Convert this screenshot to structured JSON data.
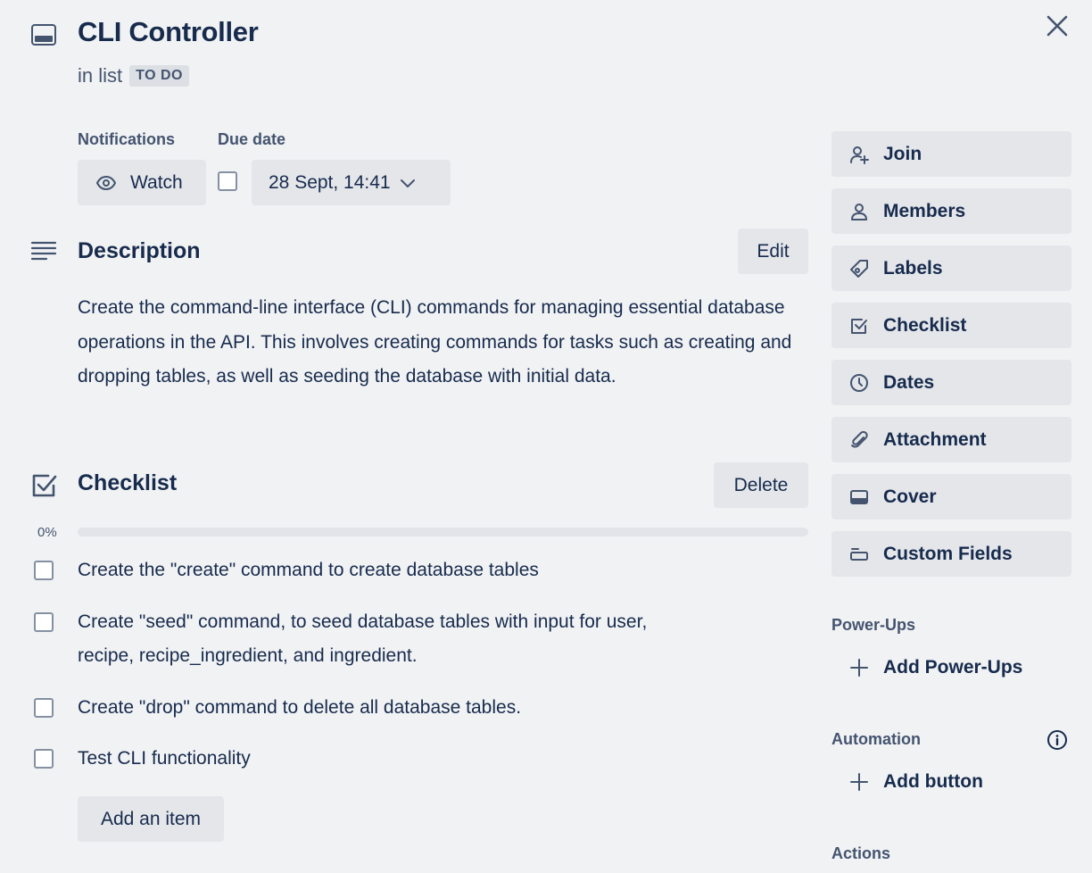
{
  "card": {
    "title": "CLI Controller",
    "in_list_prefix": "in list",
    "list_name": "TO DO"
  },
  "notifications": {
    "label": "Notifications",
    "watch_label": "Watch"
  },
  "due_date": {
    "label": "Due date",
    "value": "28 Sept, 14:41",
    "complete": false
  },
  "description": {
    "heading": "Description",
    "edit_label": "Edit",
    "text": "Create the command-line interface (CLI) commands for managing essential database operations in the API. This involves creating commands for tasks such as creating and dropping tables, as well as seeding the database with initial data."
  },
  "checklist": {
    "heading": "Checklist",
    "delete_label": "Delete",
    "progress_label": "0%",
    "progress": 0,
    "items": [
      {
        "text": "Create the \"create\" command to create database tables",
        "checked": false
      },
      {
        "text": "Create \"seed\" command, to seed database tables with input for user, recipe, recipe_ingredient, and ingredient.",
        "checked": false
      },
      {
        "text": "Create \"drop\" command to delete all database tables.",
        "checked": false
      },
      {
        "text": "Test CLI functionality",
        "checked": false
      }
    ],
    "add_item_label": "Add an item"
  },
  "sidebar": {
    "buttons": [
      {
        "label": "Join",
        "icon": "add-member-icon"
      },
      {
        "label": "Members",
        "icon": "person-icon"
      },
      {
        "label": "Labels",
        "icon": "tag-icon"
      },
      {
        "label": "Checklist",
        "icon": "checkbox-icon"
      },
      {
        "label": "Dates",
        "icon": "clock-icon"
      },
      {
        "label": "Attachment",
        "icon": "paperclip-icon"
      },
      {
        "label": "Cover",
        "icon": "cover-icon"
      },
      {
        "label": "Custom Fields",
        "icon": "custom-fields-icon"
      }
    ],
    "power_ups_heading": "Power-Ups",
    "add_power_ups_label": "Add Power-Ups",
    "automation_heading": "Automation",
    "add_button_label": "Add button",
    "actions_heading": "Actions"
  },
  "colors": {
    "background": "#f1f2f4",
    "text": "#172b4d",
    "subtle_text": "#44546f",
    "button_bg": "#e4e6ea"
  }
}
